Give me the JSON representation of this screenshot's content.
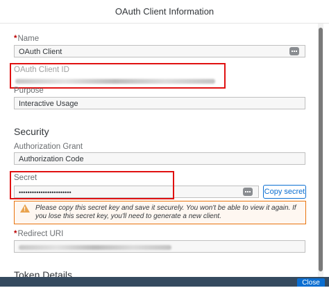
{
  "dialog": {
    "title": "OAuth Client Information",
    "close_label": "Close"
  },
  "form": {
    "name_label": "Name",
    "name_value": "OAuth Client",
    "client_id_label": "OAuth Client ID",
    "purpose_label": "Purpose",
    "purpose_value": "Interactive Usage",
    "security_heading": "Security",
    "grant_label": "Authorization Grant",
    "grant_value": "Authorization Code",
    "secret_label": "Secret",
    "secret_value": "••••••••••••••••••••••••",
    "copy_secret_label": "Copy secret",
    "warning_text": "Please copy this secret key and save it securely. You won't be able to view it again. If you lose this secret key, you'll need to generate a new client.",
    "redirect_label": "Redirect URI",
    "token_heading": "Token Details"
  },
  "colors": {
    "highlight": "#e01010",
    "accent": "#0a6ed1",
    "warning_border": "#e9730c"
  }
}
